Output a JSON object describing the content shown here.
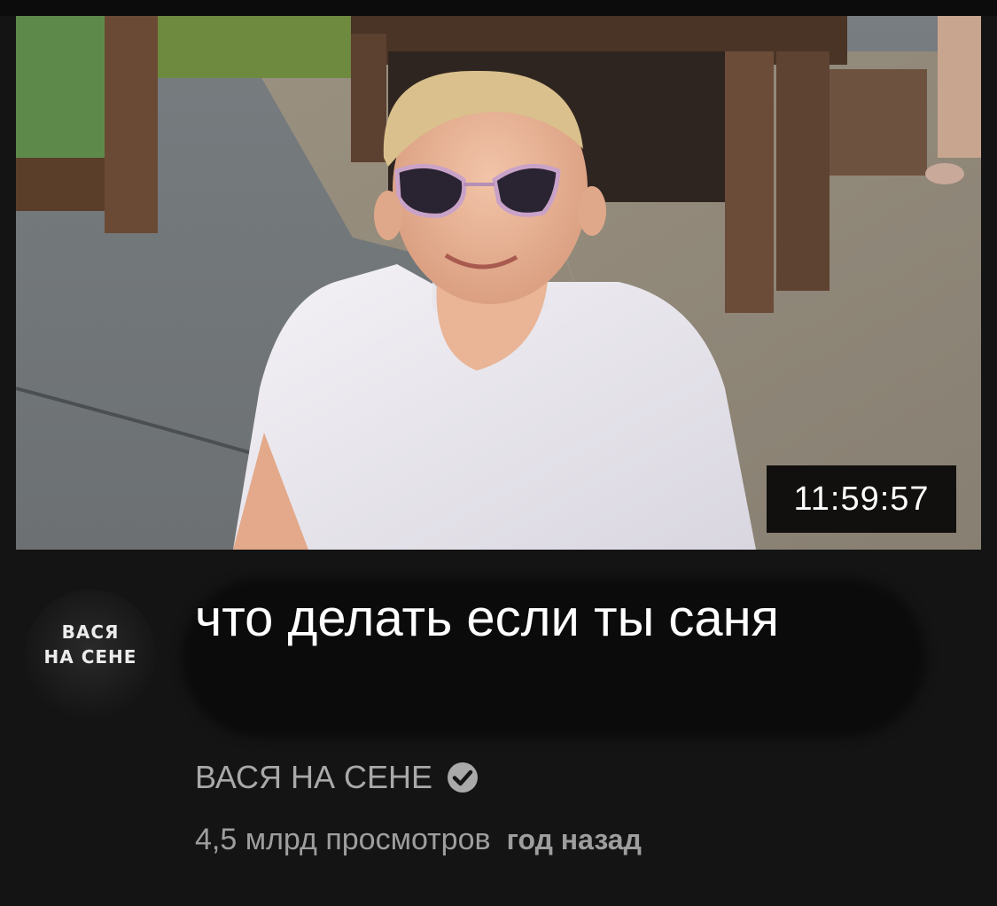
{
  "video": {
    "duration": "11:59:57",
    "title": "что делать если ты саня",
    "channel_name": "ВАСЯ НА СЕНЕ",
    "views": "4,5 млрд просмотров",
    "age": "год назад"
  },
  "avatar": {
    "line1": "ВАСЯ",
    "line2": "НА СЕНЕ"
  },
  "icons": {
    "verified": "check-circle-icon"
  },
  "colors": {
    "background": "#141414",
    "title": "#ffffff",
    "secondary_text": "#9e9e9e",
    "badge_bg": "#000000"
  }
}
